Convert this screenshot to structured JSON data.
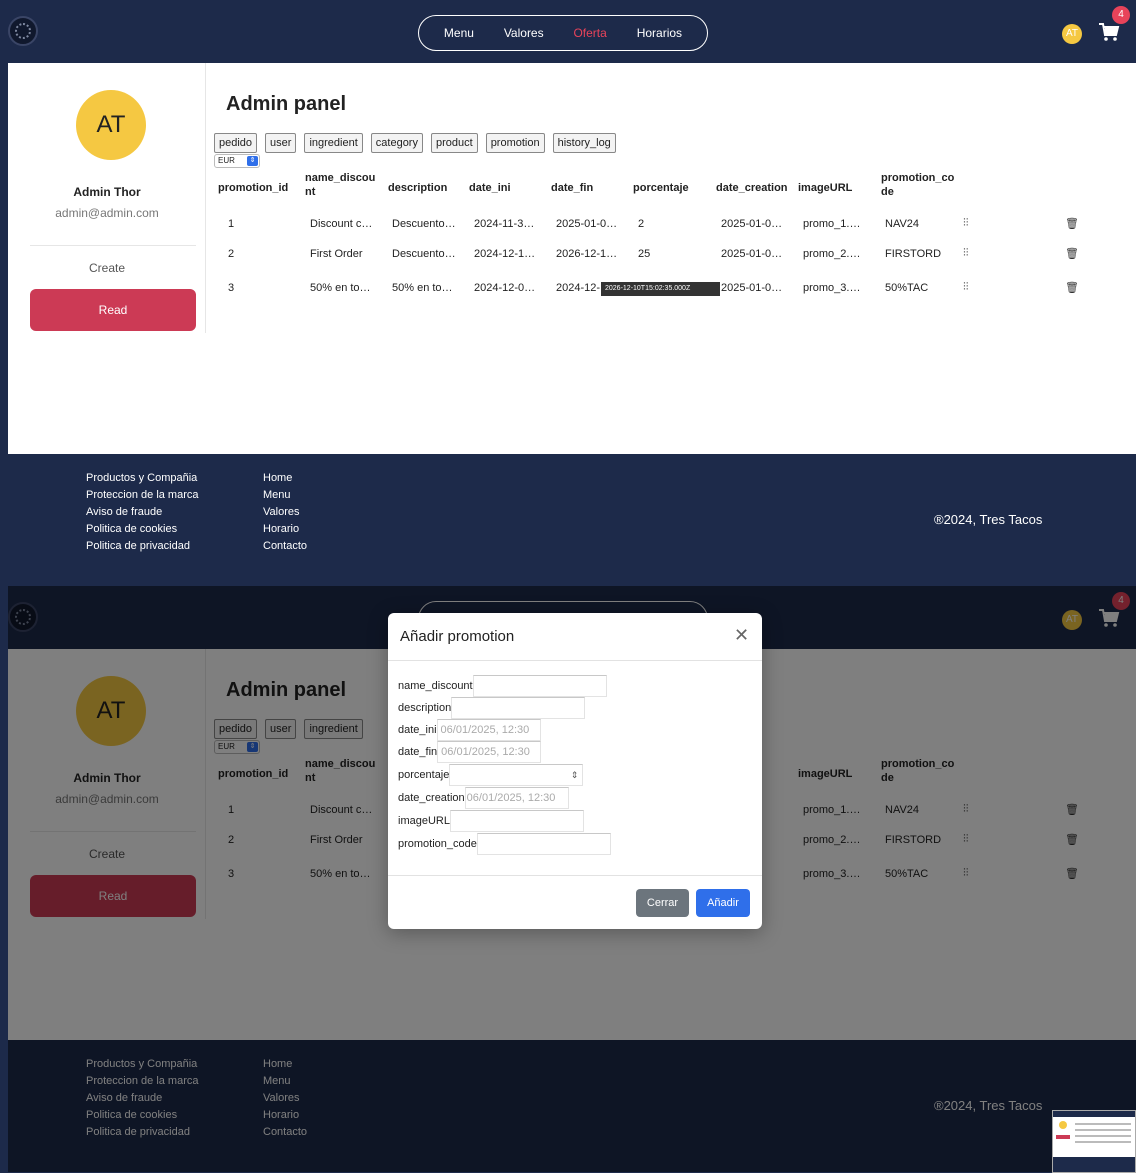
{
  "nav": {
    "links": [
      "Menu",
      "Valores",
      "Oferta",
      "Horarios"
    ],
    "active": "Oferta",
    "avatar_initials": "AT",
    "cart_count": "4"
  },
  "sidebar": {
    "initials": "AT",
    "name": "Admin Thor",
    "email": "admin@admin.com",
    "create_label": "Create",
    "read_label": "Read"
  },
  "main": {
    "title": "Admin panel",
    "tabs": [
      "pedido",
      "user",
      "ingredient",
      "category",
      "product",
      "promotion",
      "history_log"
    ],
    "currency": "EUR"
  },
  "table": {
    "headers": [
      "promotion_id",
      "name_discou nt",
      "description",
      "date_ini",
      "date_fin",
      "porcentaje",
      "date_creation",
      "imageURL",
      "promotion_co de"
    ],
    "rows": [
      [
        "1",
        "Discount c…",
        "Descuento…",
        "2024-11-3…",
        "2025-01-0…",
        "2",
        "2025-01-0…",
        "promo_1.…",
        "NAV24"
      ],
      [
        "2",
        "First Order",
        "Descuento…",
        "2024-12-1…",
        "2026-12-1…",
        "25",
        "2025-01-0…",
        "promo_2.…",
        "FIRSTORD"
      ],
      [
        "3",
        "50% en to…",
        "50% en to…",
        "2024-12-0…",
        "2024-12-",
        "",
        "2025-01-0…",
        "promo_3.…",
        "50%TAC"
      ]
    ],
    "tooltip": "2026-12-10T15:02:35.000Z"
  },
  "footer": {
    "col1": [
      "Productos y Compañia",
      "Proteccion de la marca",
      "Aviso de fraude",
      "Politica de cookies",
      "Politica de privacidad"
    ],
    "col2": [
      "Home",
      "Menu",
      "Valores",
      "Horario",
      "Contacto"
    ],
    "copyright": "®2024, Tres Tacos"
  },
  "modal": {
    "title": "Añadir promotion",
    "fields": [
      {
        "label": "name_discount",
        "value": ""
      },
      {
        "label": "description",
        "value": ""
      },
      {
        "label": "date_ini",
        "value": "06/01/2025, 12:30"
      },
      {
        "label": "date_fin",
        "value": "06/01/2025, 12:30"
      },
      {
        "label": "porcentaje",
        "value": ""
      },
      {
        "label": "date_creation",
        "value": "06/01/2025, 12:30"
      },
      {
        "label": "imageURL",
        "value": ""
      },
      {
        "label": "promotion_code",
        "value": ""
      }
    ],
    "close_label": "Cerrar",
    "add_label": "Añadir"
  }
}
